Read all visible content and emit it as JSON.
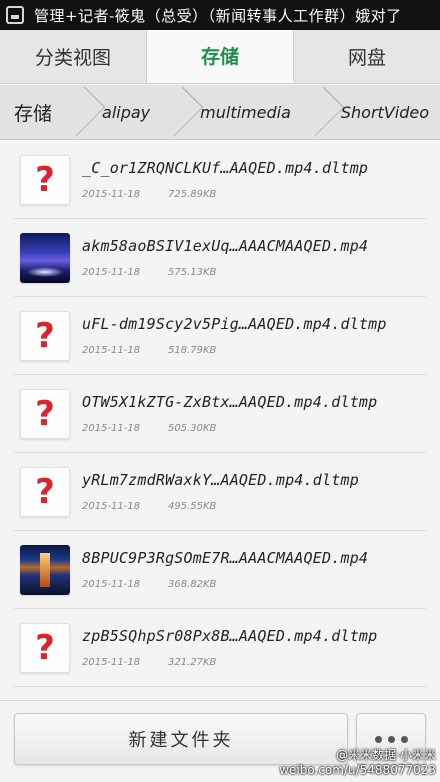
{
  "status_bar": {
    "text": "管理+记者-筱鬼（总受）（新闻转事人工作群）娥对了"
  },
  "tabs": [
    {
      "label": "分类视图",
      "active": false
    },
    {
      "label": "存储",
      "active": true
    },
    {
      "label": "网盘",
      "active": false
    }
  ],
  "breadcrumb": [
    "存储",
    "alipay",
    "multimedia",
    "ShortVideo"
  ],
  "files": [
    {
      "name": "_C_or1ZRQNCLKUf…AAQED.mp4.dltmp",
      "date": "2015-11-18",
      "size": "725.89KB",
      "thumb": "unknown"
    },
    {
      "name": "akm58aoBSIV1exUq…AAACMAAQED.mp4",
      "date": "2015-11-18",
      "size": "575.13KB",
      "thumb": "video1"
    },
    {
      "name": "uFL-dm19Scy2v5Pig…AAQED.mp4.dltmp",
      "date": "2015-11-18",
      "size": "518.79KB",
      "thumb": "unknown"
    },
    {
      "name": "OTW5X1kZTG-ZxBtx…AAQED.mp4.dltmp",
      "date": "2015-11-18",
      "size": "505.30KB",
      "thumb": "unknown"
    },
    {
      "name": "yRLm7zmdRWaxkY…AAQED.mp4.dltmp",
      "date": "2015-11-18",
      "size": "495.55KB",
      "thumb": "unknown"
    },
    {
      "name": "8BPUC9P3RgSOmE7R…AAACMAAQED.mp4",
      "date": "2015-11-18",
      "size": "368.82KB",
      "thumb": "video2"
    },
    {
      "name": "zpB5SQhpSr08Px8B…AAQED.mp4.dltmp",
      "date": "2015-11-18",
      "size": "321.27KB",
      "thumb": "unknown"
    }
  ],
  "bottom": {
    "new_folder_label": "新建文件夹"
  },
  "watermark": {
    "line1": "@米米数据·小米米",
    "line2": "weibo.com/u/5488077023"
  },
  "colors": {
    "active_tab": "#1e8f4f",
    "unknown_icon": "#d8252e"
  },
  "icons": {
    "unknown_file": "question-mark-icon",
    "more": "more-dots-icon"
  }
}
